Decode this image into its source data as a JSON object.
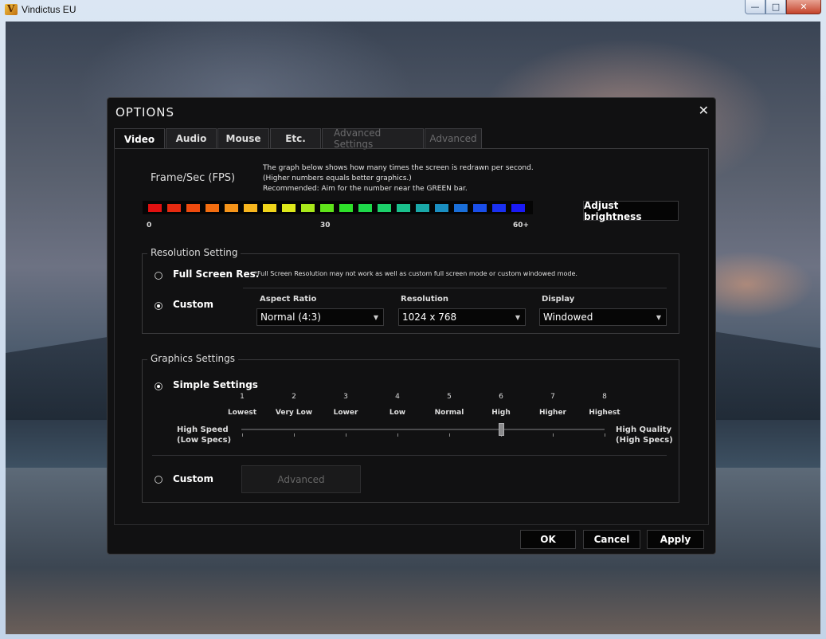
{
  "window": {
    "title": "Vindictus EU",
    "controls": {
      "minimize": "—",
      "maximize": "□",
      "close": "✕"
    }
  },
  "dialog": {
    "title": "OPTIONS",
    "close_glyph": "✕",
    "tabs": [
      {
        "label": "Video",
        "active": true
      },
      {
        "label": "Audio"
      },
      {
        "label": "Mouse"
      },
      {
        "label": "Etc."
      },
      {
        "label": "Advanced Settings",
        "disabled": true
      },
      {
        "label": "Advanced",
        "disabled": true
      }
    ],
    "fps": {
      "label": "Frame/Sec (FPS)",
      "desc_line1": "The graph below shows how many times the screen is redrawn per second.",
      "desc_line2": "(Higher numbers equals better graphics.)",
      "desc_line3": "Recommended: Aim for the number near the GREEN bar.",
      "tick_min": "0",
      "tick_mid": "30",
      "tick_max": "60+",
      "colors": [
        "#e01010",
        "#e52a10",
        "#ee4a0e",
        "#f26d10",
        "#f5941a",
        "#f7b51e",
        "#f0d41a",
        "#dde81a",
        "#a8e81a",
        "#5fe31a",
        "#2ee02a",
        "#1ed84a",
        "#1cd06a",
        "#1ac08c",
        "#1aa8a8",
        "#1a8ec0",
        "#1a6ed8",
        "#1a4ee8",
        "#1a30f0",
        "#1a1af5"
      ],
      "adjust_brightness": "Adjust brightness"
    },
    "resolution": {
      "legend": "Resolution Setting",
      "fullscreen_label": "Full Screen Res.",
      "fullscreen_note": "*Full Screen Resolution may not work as well as custom full screen mode or custom windowed mode.",
      "custom_label": "Custom",
      "selected": "custom",
      "aspect_label": "Aspect Ratio",
      "aspect_value": "Normal (4:3)",
      "res_label": "Resolution",
      "res_value": "1024 x 768",
      "display_label": "Display",
      "display_value": "Windowed"
    },
    "graphics": {
      "legend": "Graphics Settings",
      "simple_label": "Simple Settings",
      "selected": "simple",
      "levels": [
        {
          "num": "1",
          "name": "Lowest"
        },
        {
          "num": "2",
          "name": "Very Low"
        },
        {
          "num": "3",
          "name": "Lower"
        },
        {
          "num": "4",
          "name": "Low"
        },
        {
          "num": "5",
          "name": "Normal"
        },
        {
          "num": "6",
          "name": "High"
        },
        {
          "num": "7",
          "name": "Higher"
        },
        {
          "num": "8",
          "name": "Highest"
        }
      ],
      "current_level": 6,
      "left_label_1": "High Speed",
      "left_label_2": "(Low Specs)",
      "right_label_1": "High Quality",
      "right_label_2": "(High Specs)",
      "custom_label": "Custom",
      "advanced_button": "Advanced"
    },
    "buttons": {
      "ok": "OK",
      "cancel": "Cancel",
      "apply": "Apply"
    }
  }
}
